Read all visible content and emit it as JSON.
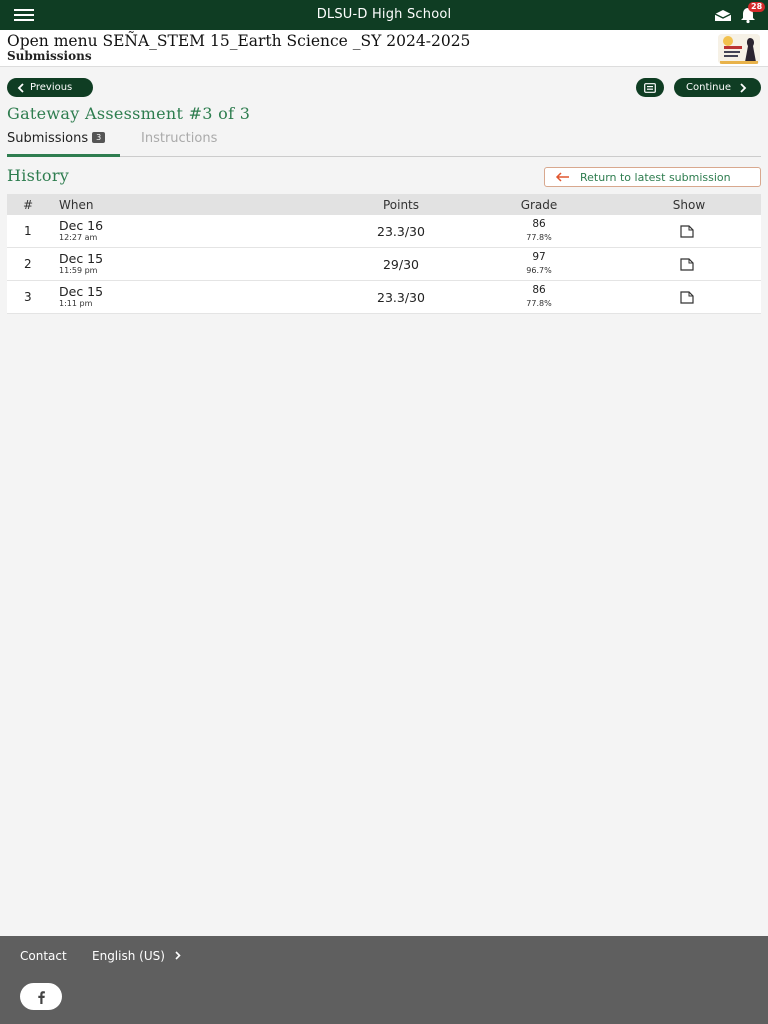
{
  "topbar": {
    "school_name": "DLSU-D High School",
    "notification_count": "28"
  },
  "course": {
    "title": "Open menu SEÑA_STEM 15_Earth Science _SY 2024-2025",
    "subtitle": "Submissions"
  },
  "nav": {
    "previous_label": "Previous",
    "continue_label": "Continue"
  },
  "assessment": {
    "title": "Gateway Assessment #3 of 3"
  },
  "tabs": {
    "submissions_label": "Submissions",
    "submissions_count": "3",
    "instructions_label": "Instructions"
  },
  "history": {
    "title": "History",
    "return_label": "Return to latest submission"
  },
  "table": {
    "headers": {
      "num": "#",
      "when": "When",
      "points": "Points",
      "grade": "Grade",
      "show": "Show"
    },
    "rows": [
      {
        "num": "1",
        "date": "Dec 16",
        "time": "12:27 am",
        "points": "23.3/30",
        "grade": "86",
        "percent": "77.8%"
      },
      {
        "num": "2",
        "date": "Dec 15",
        "time": "11:59 pm",
        "points": "29/30",
        "grade": "97",
        "percent": "96.7%"
      },
      {
        "num": "3",
        "date": "Dec 15",
        "time": "1:11 pm",
        "points": "23.3/30",
        "grade": "86",
        "percent": "77.8%"
      }
    ]
  },
  "footer": {
    "contact_label": "Contact",
    "language_label": "English (US)"
  },
  "colors": {
    "primary_dark": "#0f3d23",
    "accent_green": "#2e7d4f",
    "badge_red": "#d52b2b",
    "return_arrow": "#e0562f",
    "footer_bg": "#5f5f5f"
  }
}
